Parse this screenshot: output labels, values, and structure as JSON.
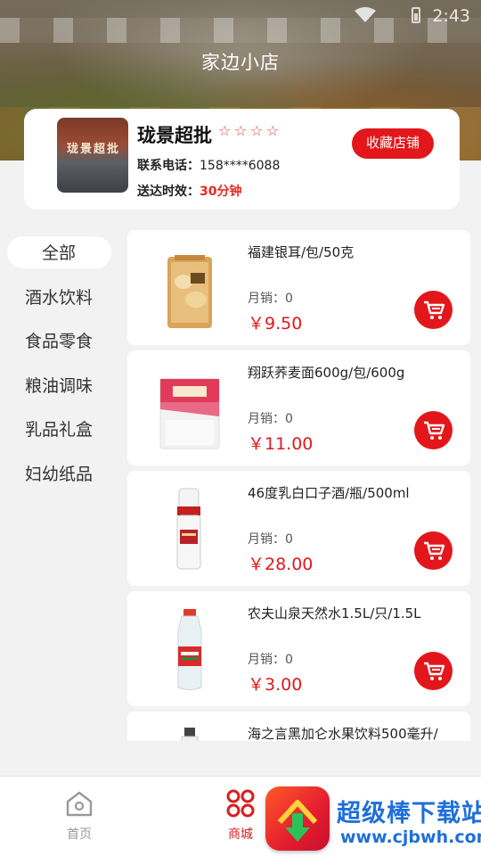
{
  "status_bar": {
    "time": "2:43"
  },
  "header": {
    "title": "家边小店"
  },
  "store": {
    "photo_sign": "珑景超批",
    "name": "珑景超批",
    "rating_stars": 4,
    "rating_filled": 0,
    "phone_label": "联系电话：",
    "phone": "158****6088",
    "delivery_label": "送达时效：",
    "delivery": "30分钟",
    "favorite_label": "收藏店铺"
  },
  "categories": [
    {
      "label": "全部",
      "active": true
    },
    {
      "label": "酒水饮料"
    },
    {
      "label": "食品零食"
    },
    {
      "label": "粮油调味"
    },
    {
      "label": "乳品礼盒"
    },
    {
      "label": "妇幼纸品"
    }
  ],
  "products": [
    {
      "name": "福建银耳/包/50克",
      "sales": "月销：0",
      "price": "￥9.50",
      "image": "white-fungus-bag"
    },
    {
      "name": "翔跃荞麦面600g/包/600g",
      "sales": "月销：0",
      "price": "￥11.00",
      "image": "buckwheat-noodle-bag"
    },
    {
      "name": "46度乳白口子酒/瓶/500ml",
      "sales": "月销：0",
      "price": "￥28.00",
      "image": "liquor-bottle"
    },
    {
      "name": "农夫山泉天然水1.5L/只/1.5L",
      "sales": "月销：0",
      "price": "￥3.00",
      "image": "water-bottle"
    },
    {
      "name": "海之言黑加仑水果饮料500毫升/",
      "sales": "",
      "price": "",
      "image": "drink-bottle"
    }
  ],
  "tabbar": {
    "home_label": "首页",
    "shop_label": "商城"
  },
  "watermark": {
    "title": "超级棒下载站",
    "url": "www.cjbwh.com"
  },
  "colors": {
    "accent": "#e3171b",
    "price": "#e3171b",
    "background": "#f2f2f2"
  }
}
